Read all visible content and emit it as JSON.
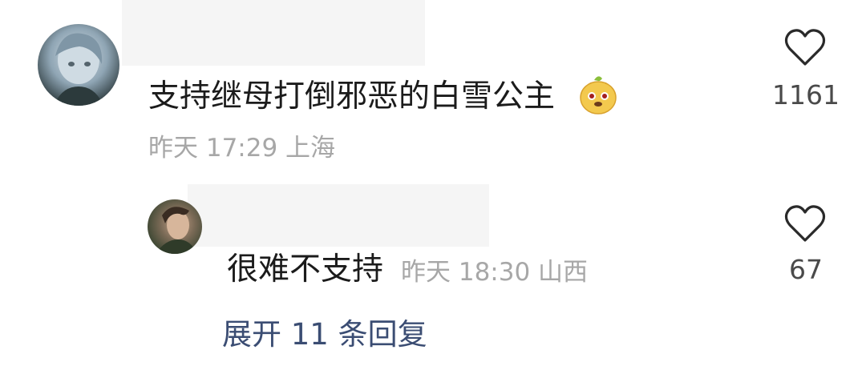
{
  "comment": {
    "text": "支持继母打倒邪恶的白雪公主",
    "emoji": "smiling-sticker",
    "time": "昨天 17:29 上海",
    "likes": "1161",
    "reply": {
      "text": "很难不支持",
      "time": "昨天 18:30 山西",
      "likes": "67"
    },
    "expand_label": "展开 11 条回复"
  },
  "icons": {
    "like": "heart-outline-icon"
  },
  "colors": {
    "text": "#1b1b1b",
    "meta": "#a7a7a7",
    "like_count": "#4a4a4a",
    "link": "#3b4d73"
  }
}
